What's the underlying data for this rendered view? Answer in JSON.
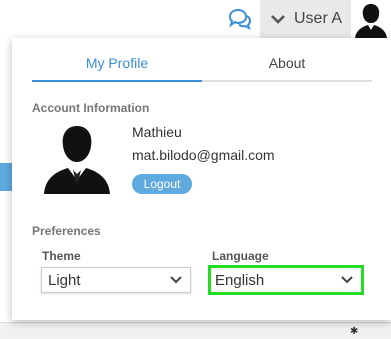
{
  "header": {
    "user_label": "User A",
    "icons": {
      "chat": "chat-bubbles-icon",
      "chevron": "chevron-down-icon",
      "avatar": "user-silhouette-icon"
    }
  },
  "panel": {
    "tabs": [
      {
        "label": "My Profile",
        "active": true
      },
      {
        "label": "About",
        "active": false
      }
    ],
    "account": {
      "section_title": "Account Information",
      "name": "Mathieu",
      "email": "mat.bilodo@gmail.com",
      "logout_label": "Logout"
    },
    "preferences": {
      "section_title": "Preferences",
      "theme_label": "Theme",
      "theme_value": "Light",
      "language_label": "Language",
      "language_value": "English"
    }
  },
  "colors": {
    "accent": "#3a8fd6",
    "button": "#5ea9de",
    "highlight": "#22dd22"
  }
}
